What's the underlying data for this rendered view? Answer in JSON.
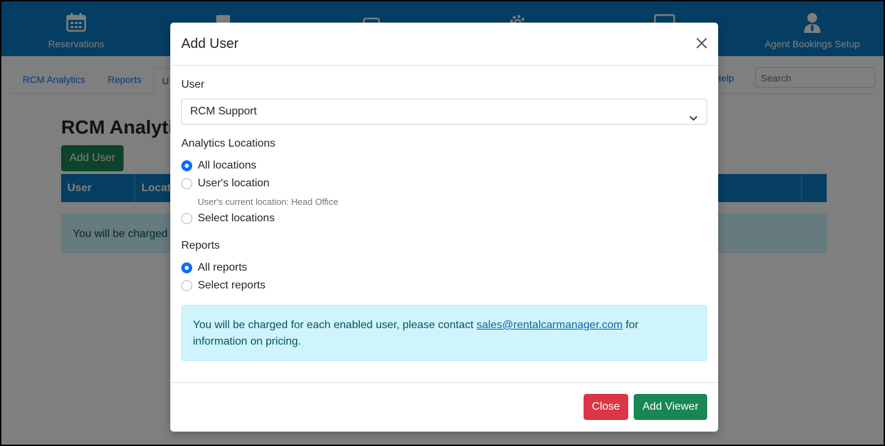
{
  "topnav": {
    "items": [
      {
        "label": "Reservations",
        "icon": "calendar-icon"
      },
      {
        "label": "",
        "icon": "clipboard-icon"
      },
      {
        "label": "",
        "icon": "car-icon"
      },
      {
        "label": "",
        "icon": "gear-icon"
      },
      {
        "label": "",
        "icon": "monitor-icon"
      },
      {
        "label": "Agent Bookings Setup",
        "icon": "user-tie-icon"
      }
    ]
  },
  "subnav": {
    "tabs": [
      "RCM Analytics",
      "Reports",
      "U"
    ],
    "help": "Help",
    "search_placeholder": "Search"
  },
  "page": {
    "title": "RCM Analytic",
    "add_user_label": "Add User",
    "table_headers": [
      "User",
      "Locat"
    ],
    "alert_text": "You will be charged"
  },
  "modal": {
    "title": "Add User",
    "user_label": "User",
    "user_selected": "RCM Support",
    "locations_label": "Analytics Locations",
    "location_options": [
      {
        "label": "All locations",
        "checked": true
      },
      {
        "label": "User's location",
        "checked": false
      },
      {
        "label": "Select locations",
        "checked": false
      }
    ],
    "current_location_hint": "User's current location: Head Office",
    "reports_label": "Reports",
    "report_options": [
      {
        "label": "All reports",
        "checked": true
      },
      {
        "label": "Select reports",
        "checked": false
      }
    ],
    "info_before": "You will be charged for each enabled user, please contact ",
    "info_email": "sales@rentalcarmanager.com",
    "info_after": " for information on pricing.",
    "close_label": "Close",
    "add_viewer_label": "Add Viewer"
  },
  "colors": {
    "brand_blue": "#0b7cc4",
    "success_green": "#198754",
    "danger_red": "#dc3545",
    "info_bg": "#cff4fc",
    "radio_blue": "#0d6efd"
  }
}
